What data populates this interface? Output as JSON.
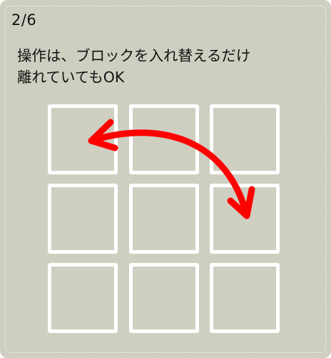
{
  "step": {
    "counter": "2/6"
  },
  "instruction": {
    "line1": "操作は、ブロックを入れ替えるだけ",
    "line2": "離れていてもOK"
  },
  "grid": {
    "rows": 3,
    "cols": 3
  },
  "arrow": {
    "icon": "swap-arrow-icon",
    "color": "#ff0000"
  },
  "colors": {
    "background": "#cfcfc1",
    "tile_border": "#ffffff"
  }
}
